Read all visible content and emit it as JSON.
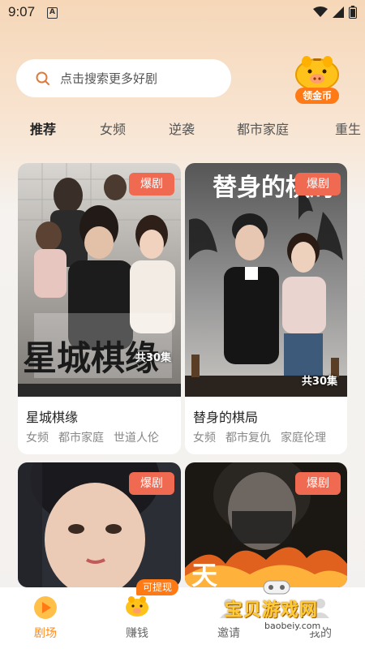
{
  "status": {
    "time": "9:07",
    "a_icon": "A"
  },
  "search": {
    "placeholder": "点击搜索更多好剧"
  },
  "coin": {
    "label": "领金币"
  },
  "tabs": [
    "推荐",
    "女频",
    "逆袭",
    "都市家庭",
    "重生"
  ],
  "cards": [
    {
      "title": "星城棋缘",
      "badge": "爆剧",
      "episodes": "共30集",
      "poster_text": "星城棋缘",
      "tags": [
        "女频",
        "都市家庭",
        "世道人伦"
      ]
    },
    {
      "title": "替身的棋局",
      "badge": "爆剧",
      "episodes": "共30集",
      "poster_text": "替身的棋局",
      "tags": [
        "女频",
        "都市复仇",
        "家庭伦理"
      ]
    },
    {
      "badge": "爆剧"
    },
    {
      "badge": "爆剧",
      "poster_text": "天"
    }
  ],
  "bottom_nav": [
    {
      "label": "剧场",
      "icon": "play-icon",
      "active": true
    },
    {
      "label": "赚钱",
      "icon": "piggy-icon",
      "active": false
    },
    {
      "label": "邀请",
      "icon": "invite-icon",
      "active": false
    },
    {
      "label": "我的",
      "icon": "profile-icon",
      "active": false
    }
  ],
  "earn_pill": "可提现",
  "watermark": {
    "text": "宝贝游戏网",
    "url": "baobeiy.com"
  },
  "colors": {
    "accent": "#ff8a1c",
    "badge": "#f06a52",
    "coin": "#ff7a14"
  }
}
